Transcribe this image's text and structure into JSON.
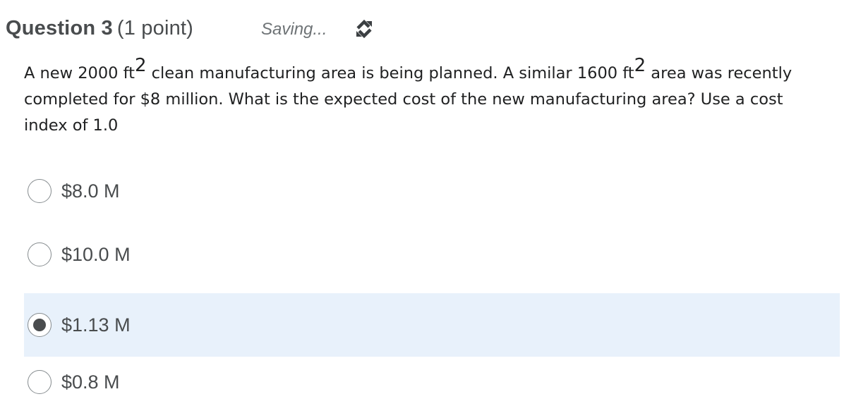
{
  "question": {
    "label": "Question 3",
    "points": "(1 point)",
    "status": "Saving...",
    "status_icon": "sync-icon",
    "text_parts": {
      "p1": "A new 2000 ft",
      "sup1": "2",
      "p2": " clean manufacturing area is being planned. A similar 1600 ft",
      "sup2": "2",
      "p3": " area was recently completed for $8 million. What is the expected cost of the new manufacturing area? Use a cost index of 1.0"
    }
  },
  "options": [
    {
      "label": "$8.0 M",
      "selected": false
    },
    {
      "label": "$10.0 M",
      "selected": false
    },
    {
      "label": "$1.13 M",
      "selected": true
    },
    {
      "label": "$0.8 M",
      "selected": false
    }
  ],
  "colors": {
    "selected_background": "#e8f1fb",
    "title": "#494c4e",
    "radio_border": "#868c8f"
  }
}
